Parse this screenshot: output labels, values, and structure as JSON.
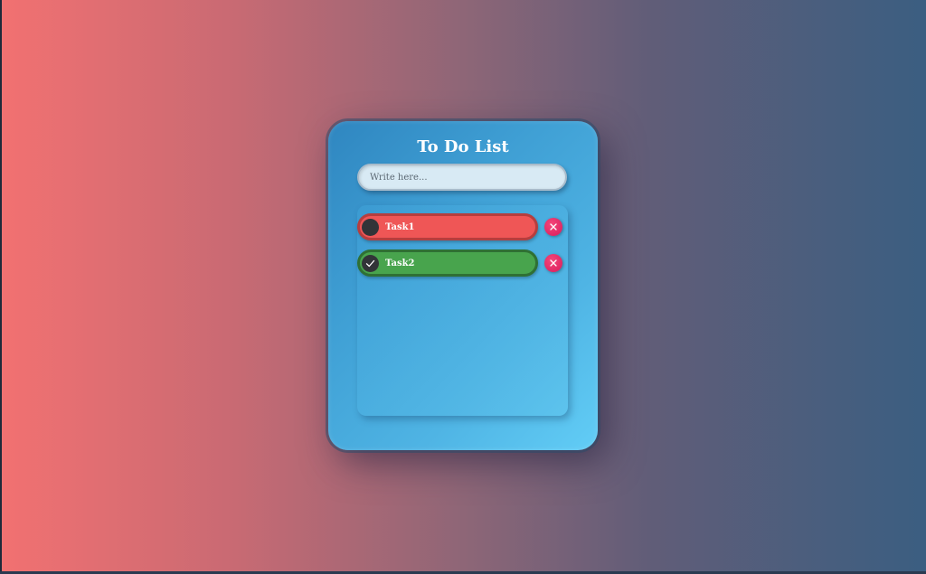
{
  "app": {
    "title": "To Do List"
  },
  "input": {
    "placeholder": "Write here..."
  },
  "tasks": [
    {
      "label": "Task1",
      "completed": false,
      "color": "#ef5656"
    },
    {
      "label": "Task2",
      "completed": true,
      "color": "#48a44d"
    }
  ],
  "icons": {
    "check": "checkmark-icon",
    "delete": "close-icon"
  },
  "colors": {
    "delete_button": "#e8286a",
    "card_start": "#2f86c0",
    "card_end": "#62cdf6"
  }
}
